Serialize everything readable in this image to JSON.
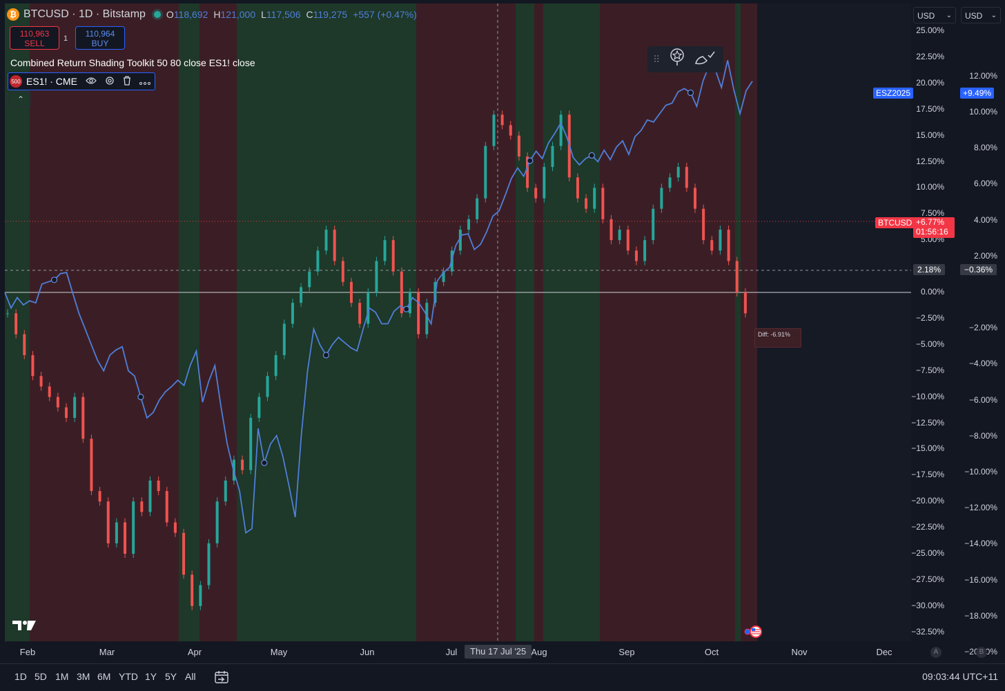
{
  "header": {
    "symbol_title": "BTCUSD · 1D · Bitstamp",
    "btc_logo_glyph": "₿",
    "open_key": "O",
    "open_val": "118,692",
    "high_key": "H",
    "high_val": "121,000",
    "low_key": "L",
    "low_val": "117,506",
    "close_key": "C",
    "close_val": "119,275",
    "change": "+557 (+0.47%)"
  },
  "trade": {
    "sell_price": "110,963",
    "sell_label": "SELL",
    "qty": "1",
    "buy_price": "110,964",
    "buy_label": "BUY"
  },
  "indicator": {
    "label": "Combined Return Shading Toolkit 50 80 close ES1! close"
  },
  "symbol_row": {
    "badge": "500",
    "label": "ES1! · CME",
    "icons": [
      "eye-icon",
      "gear-icon",
      "trash-icon",
      "more-icon"
    ]
  },
  "collapse_glyph": "⌃",
  "currency": {
    "left": "USD",
    "right": "USD"
  },
  "price_labels": {
    "esz_name": "ESZ2025",
    "esz_value": "+9.49%",
    "btc_name": "BTCUSD",
    "btc_value": "+6.77%",
    "btc_timer": "01:56:16",
    "crosshair_left": "2.18%",
    "crosshair_right": "−0.36%",
    "diff": "Diff: -6.91%",
    "crosshair_date": "Thu 17 Jul '25"
  },
  "colors": {
    "bg": "#131722",
    "green_shade": "#1f3a2a",
    "red_shade": "#3d1f26",
    "line": "#4f7fd9",
    "up": "#26a69a",
    "down": "#ef5350"
  },
  "chart_data": {
    "type": "line",
    "x_months": [
      "Feb",
      "Mar",
      "Apr",
      "May",
      "Jun",
      "Jul",
      "Aug",
      "Sep",
      "Oct",
      "Nov",
      "Dec"
    ],
    "left_axis": {
      "ticks": [
        "25.00%",
        "22.50%",
        "20.00%",
        "17.50%",
        "15.00%",
        "12.50%",
        "10.00%",
        "7.50%",
        "5.00%",
        "0.00%",
        "−2.50%",
        "−5.00%",
        "−7.50%",
        "−10.00%",
        "−12.50%",
        "−15.00%",
        "−17.50%",
        "−20.00%",
        "−22.50%",
        "−25.00%",
        "−27.50%",
        "−30.00%",
        "−32.50%"
      ]
    },
    "right_axis": {
      "ticks": [
        "12.00%",
        "10.00%",
        "8.00%",
        "6.00%",
        "4.00%",
        "2.00%",
        "−2.00%",
        "−4.00%",
        "−6.00%",
        "−8.00%",
        "−10.00%",
        "−12.00%",
        "−14.00%",
        "−16.00%",
        "−18.00%",
        "−20.00%"
      ]
    },
    "series": [
      {
        "name": "ES1!",
        "points": [
          0,
          -1.5,
          -0.5,
          -1.2,
          -0.8,
          -1,
          0.8,
          1,
          1.2,
          1.8,
          1.9,
          -0.1,
          -2,
          -3.5,
          -5,
          -6.5,
          -7.5,
          -6,
          -5.5,
          -5.2,
          -7.5,
          -8,
          -10,
          -12,
          -11.5,
          -10.3,
          -9.5,
          -9,
          -8.4,
          -8.9,
          -7,
          -5.6,
          -10.5,
          -8.5,
          -7,
          -11,
          -14.5,
          -17,
          -19,
          -23,
          -22.6,
          -13,
          -16.3,
          -14.5,
          -13.7,
          -15.7,
          -18.5,
          -21.5,
          -13.6,
          -7.5,
          -3.5,
          -5,
          -6,
          -5,
          -4.3,
          -4.8,
          -5.3,
          -5.6,
          -3.5,
          -1.5,
          -1.9,
          -3,
          -3,
          -1.8,
          -1.3,
          -1.6,
          -0.5,
          -1,
          -1.9,
          -3,
          1.1,
          1.9,
          2.4,
          4.5,
          5.5,
          5.6,
          4.1,
          4.6,
          5.8,
          7.3,
          7.8,
          9.3,
          10.9,
          11.9,
          11.1,
          12.6,
          13.5,
          12.8,
          14.3,
          15.2,
          16.2,
          14.8,
          12.9,
          12.2,
          12.8,
          13.1,
          12.5,
          13.6,
          12.7,
          13.9,
          14.5,
          13.2,
          14.9,
          15.5,
          16.5,
          16.3,
          17.1,
          17.9,
          18.1,
          19.2,
          19.5,
          19.1,
          17.8,
          20.2,
          21.7,
          21.3,
          19.6,
          22.2,
          19.4,
          17.1,
          19.3,
          20.2
        ]
      },
      {
        "name": "BTCUSD",
        "points": [
          -2,
          -4,
          -6,
          -8,
          -9,
          -10,
          -11,
          -12,
          -10,
          -14,
          -19,
          -20,
          -24,
          -22,
          -25,
          -20,
          -21,
          -18,
          -19,
          -22,
          -23,
          -27,
          -30,
          -28,
          -24,
          -20,
          -18,
          -16,
          -17,
          -12,
          -10,
          -8,
          -6,
          -3,
          -1,
          0.5,
          2,
          4,
          6,
          3,
          1,
          -1,
          -3,
          0,
          3,
          5,
          2,
          -2,
          0,
          -4,
          -1,
          1,
          2,
          4,
          6,
          7,
          9,
          14,
          17,
          16,
          15,
          13,
          10,
          9,
          12,
          14,
          17,
          11,
          9,
          8,
          10,
          7,
          5,
          6,
          4,
          3,
          5,
          8,
          10,
          11,
          12,
          10,
          8,
          5,
          4,
          6,
          3,
          0,
          -2
        ]
      }
    ],
    "shading_bands": [
      {
        "from": 0,
        "to": 36,
        "color": "green"
      },
      {
        "from": 36,
        "to": 55,
        "color": "red"
      },
      {
        "from": 55,
        "to": 93,
        "color": "red"
      },
      {
        "from": 93,
        "to": 110,
        "color": "red"
      },
      {
        "from": 110,
        "to": 142,
        "color": "red"
      },
      {
        "from": 142,
        "to": 165,
        "color": "red"
      },
      {
        "from": 165,
        "to": 229,
        "color": "red"
      },
      {
        "from": 229,
        "to": 252,
        "color": "red"
      },
      {
        "from": 252,
        "to": 282,
        "color": "green"
      },
      {
        "from": 282,
        "to": 300,
        "color": "red"
      },
      {
        "from": 300,
        "to": 336,
        "color": "red"
      },
      {
        "from": 336,
        "to": 378,
        "color": "green"
      },
      {
        "from": 378,
        "to": 463,
        "color": "green"
      },
      {
        "from": 463,
        "to": 596,
        "color": "green"
      },
      {
        "from": 596,
        "to": 660,
        "color": "red"
      },
      {
        "from": 660,
        "to": 740,
        "color": "red"
      },
      {
        "from": 740,
        "to": 767,
        "color": "green"
      },
      {
        "from": 767,
        "to": 780,
        "color": "red"
      },
      {
        "from": 780,
        "to": 862,
        "color": "green"
      },
      {
        "from": 862,
        "to": 960,
        "color": "red"
      },
      {
        "from": 960,
        "to": 1012,
        "color": "red"
      },
      {
        "from": 1012,
        "to": 1058,
        "color": "red"
      },
      {
        "from": 1058,
        "to": 1066,
        "color": "green"
      },
      {
        "from": 1066,
        "to": 1090,
        "color": "red"
      }
    ]
  },
  "x_axis": {
    "labels": [
      "Feb",
      "Mar",
      "Apr",
      "May",
      "Jun",
      "Jul",
      "Aug",
      "Sep",
      "Oct",
      "Nov",
      "Dec"
    ],
    "axis_buttons": [
      "A",
      "B"
    ]
  },
  "timeframes": [
    "1D",
    "5D",
    "1M",
    "3M",
    "6M",
    "YTD",
    "1Y",
    "5Y",
    "All"
  ],
  "clock": "09:03:44 UTC+11"
}
